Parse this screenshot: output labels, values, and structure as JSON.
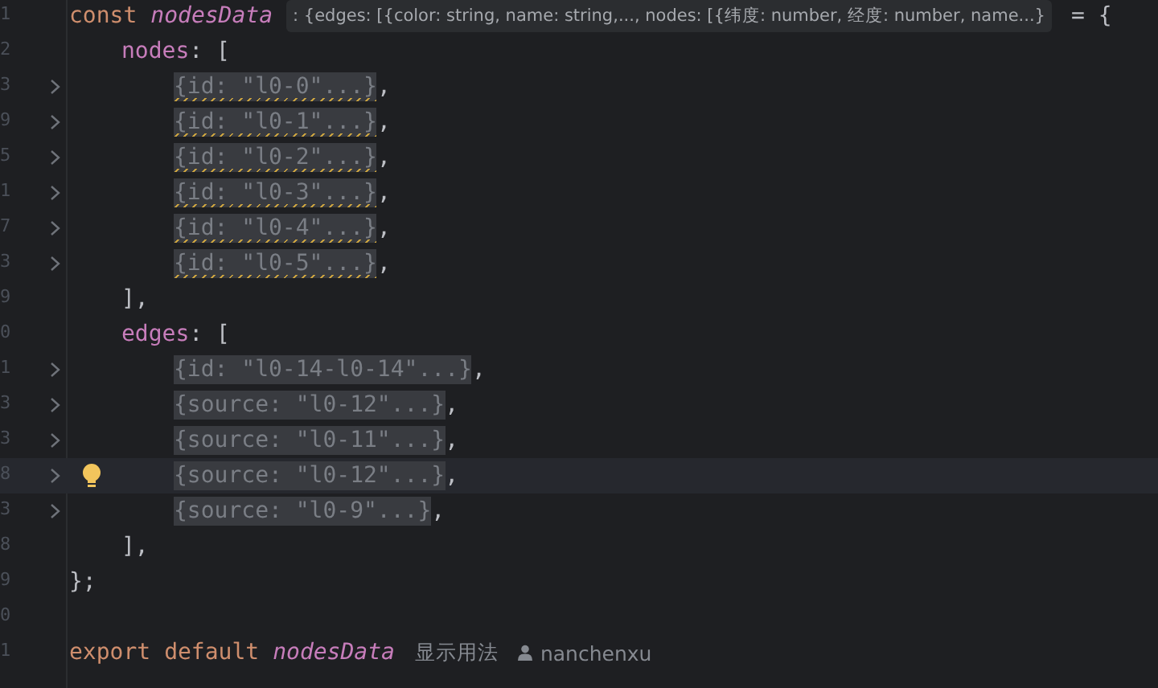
{
  "lines": [
    {
      "number": "1",
      "tokens": [
        {
          "kind": "keyword",
          "text": "const"
        },
        {
          "kind": "variable",
          "text": "nodesData"
        },
        {
          "kind": "hint",
          "text": ": {edges: [{color: string, name: string,..., nodes: [{纬度: number, 经度: number, name...}"
        },
        {
          "kind": "punct",
          "text": "= {"
        }
      ],
      "children": [
        {
          "number": "2",
          "tokens": [
            {
              "kind": "field",
              "text": "nodes"
            },
            {
              "kind": "punct",
              "text": ": ["
            }
          ],
          "children": [
            {
              "number": "3",
              "folded": true,
              "warning": true,
              "current": false,
              "tokens": [
                {
                  "kind": "fold",
                  "text": "{id: \"l0-0\"...}"
                },
                {
                  "kind": "punct",
                  "text": ","
                }
              ]
            },
            {
              "number": "9",
              "folded": true,
              "warning": true,
              "current": false,
              "tokens": [
                {
                  "kind": "fold",
                  "text": "{id: \"l0-1\"...}"
                },
                {
                  "kind": "punct",
                  "text": ","
                }
              ]
            },
            {
              "number": "5",
              "folded": true,
              "warning": true,
              "current": false,
              "tokens": [
                {
                  "kind": "fold",
                  "text": "{id: \"l0-2\"...}"
                },
                {
                  "kind": "punct",
                  "text": ","
                }
              ]
            },
            {
              "number": "1",
              "folded": true,
              "warning": true,
              "current": false,
              "tokens": [
                {
                  "kind": "fold",
                  "text": "{id: \"l0-3\"...}"
                },
                {
                  "kind": "punct",
                  "text": ","
                }
              ]
            },
            {
              "number": "7",
              "folded": true,
              "warning": true,
              "current": false,
              "tokens": [
                {
                  "kind": "fold",
                  "text": "{id: \"l0-4\"...}"
                },
                {
                  "kind": "punct",
                  "text": ","
                }
              ]
            },
            {
              "number": "3",
              "folded": true,
              "warning": true,
              "current": false,
              "tokens": [
                {
                  "kind": "fold",
                  "text": "{id: \"l0-5\"...}"
                },
                {
                  "kind": "punct",
                  "text": ","
                }
              ]
            }
          ]
        },
        {
          "number": "9",
          "tokens": [
            {
              "kind": "punct",
              "text": "],"
            }
          ]
        },
        {
          "number": "0",
          "tokens": [
            {
              "kind": "field",
              "text": "edges"
            },
            {
              "kind": "punct",
              "text": ": ["
            }
          ],
          "children": [
            {
              "number": "1",
              "folded": true,
              "warning": false,
              "current": false,
              "tokens": [
                {
                  "kind": "fold",
                  "text": "{id: \"l0-14-l0-14\"...}"
                },
                {
                  "kind": "punct",
                  "text": ","
                }
              ]
            },
            {
              "number": "3",
              "folded": true,
              "warning": false,
              "current": false,
              "tokens": [
                {
                  "kind": "fold",
                  "text": "{source: \"l0-12\"...}"
                },
                {
                  "kind": "punct",
                  "text": ","
                }
              ]
            },
            {
              "number": "3",
              "folded": true,
              "warning": false,
              "current": false,
              "tokens": [
                {
                  "kind": "fold",
                  "text": "{source: \"l0-11\"...}"
                },
                {
                  "kind": "punct",
                  "text": ","
                }
              ]
            },
            {
              "number": "8",
              "folded": true,
              "warning": false,
              "current": true,
              "tokens": [
                {
                  "kind": "fold",
                  "text": "{source: \"l0-12\"...}"
                },
                {
                  "kind": "punct",
                  "text": ","
                }
              ]
            },
            {
              "number": "3",
              "folded": true,
              "warning": false,
              "current": false,
              "tokens": [
                {
                  "kind": "fold",
                  "text": "{source: \"l0-9\"...}"
                },
                {
                  "kind": "punct",
                  "text": ","
                }
              ]
            }
          ]
        },
        {
          "number": "8",
          "tokens": [
            {
              "kind": "punct",
              "text": "],"
            }
          ]
        }
      ]
    },
    {
      "number": "9",
      "tokens": [
        {
          "kind": "punct",
          "text": "};"
        }
      ]
    },
    {
      "number": "0"
    },
    {
      "number": "1",
      "tokens": [
        {
          "kind": "keyword",
          "text": "export"
        },
        {
          "kind": "keyword",
          "text": "default"
        },
        {
          "kind": "variable",
          "text": "nodesData"
        },
        {
          "kind": "usage",
          "text": "显示用法"
        },
        {
          "kind": "author",
          "text": "nanchenxu"
        }
      ]
    }
  ]
}
